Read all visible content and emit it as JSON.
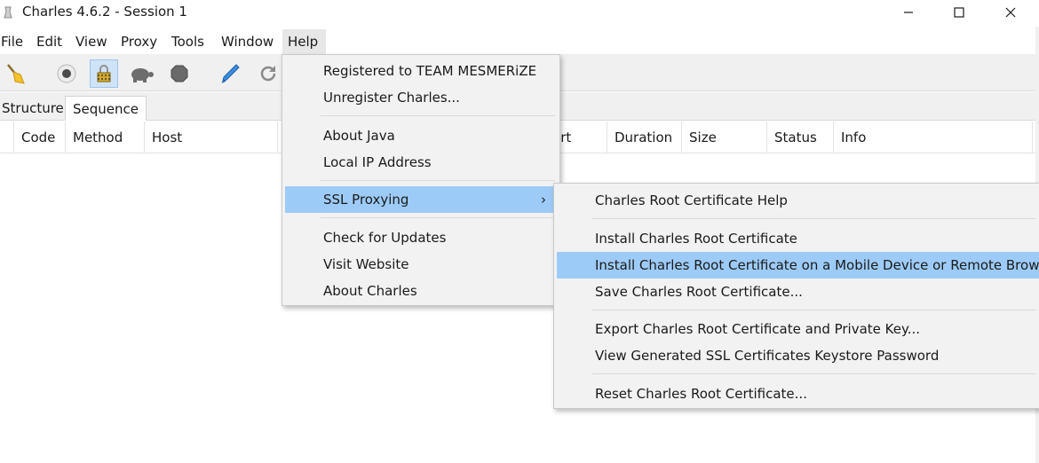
{
  "window": {
    "title": "Charles 4.6.2 - Session 1",
    "minimize_glyph": "—",
    "maximize_glyph": "☐",
    "close_glyph": "✕"
  },
  "menubar": [
    "File",
    "Edit",
    "View",
    "Proxy",
    "Tools",
    "Window",
    "Help"
  ],
  "toolbar": {
    "tools": [
      "broom-icon",
      "record-icon",
      "ssl-lock-icon",
      "throttle-turtle-icon",
      "breakpoints-hexagon-icon",
      "compose-pen-icon",
      "repeat-icon"
    ],
    "pressed": "ssl-lock-icon"
  },
  "tabs": {
    "structure": "Structure",
    "sequence": "Sequence",
    "selected": "Sequence"
  },
  "table": {
    "columns": [
      "Code",
      "Method",
      "Host",
      "art",
      "Duration",
      "Size",
      "Status",
      "Info"
    ]
  },
  "help_menu": {
    "registered": "Registered to TEAM MESMERiZE",
    "unregister": "Unregister Charles...",
    "about_java": "About Java",
    "local_ip": "Local IP Address",
    "ssl_proxying": "SSL Proxying",
    "submenu_arrow": "›",
    "check_updates": "Check for Updates",
    "visit_website": "Visit Website",
    "about_charles": "About Charles"
  },
  "ssl_submenu": {
    "root_help": "Charles Root Certificate Help",
    "install_root": "Install Charles Root Certificate",
    "install_mobile": "Install Charles Root Certificate on a Mobile Device or Remote Browser",
    "save_root": "Save Charles Root Certificate...",
    "export_root": "Export Charles Root Certificate and Private Key...",
    "view_keystore": "View Generated SSL Certificates Keystore Password",
    "reset_root": "Reset Charles Root Certificate..."
  },
  "colors": {
    "highlight": "#9dcbf7",
    "menu_bg": "#f2f2f2",
    "toolbar_bg": "#f0f0f0"
  }
}
